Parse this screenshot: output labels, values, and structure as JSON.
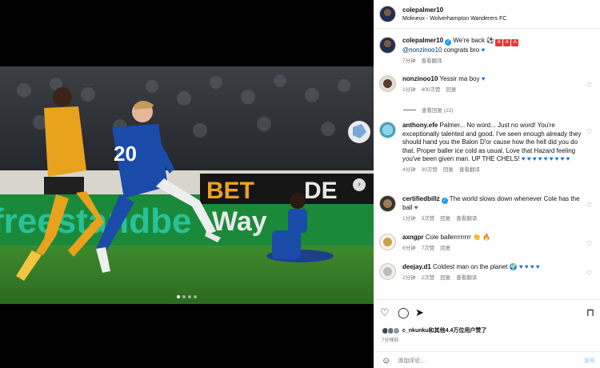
{
  "header": {
    "username": "colepalmer10",
    "location": "Molineux - Wolverhampton Wanderers FC"
  },
  "caption": {
    "username": "colepalmer10",
    "text": "We're back",
    "mention": "@nonzinoo10",
    "text2": "congrats bro",
    "time": "7分钟",
    "translate": "查看翻译"
  },
  "comments": [
    {
      "username": "nonzinoo10",
      "text": "Yessir ma boy",
      "time": "1分钟",
      "likes": "400次赞",
      "reply": "回复",
      "view_replies": "查看回复 (22)"
    },
    {
      "username": "anthony.efe",
      "text": "Palmer... No word... Just no word! You're exceptionally talented and good. I've seen enough already they should hand you the Balon D'or cause how the hell did you do that. Proper baller ice cold as usual. Love that Hazard feeling you've been given man. UP THE CHELS!",
      "time": "4分钟",
      "likes": "30次赞",
      "reply": "回复",
      "translate": "查看翻译"
    },
    {
      "username": "certifiedbillz",
      "text": "The world slows down whenever Cole has the ball",
      "time": "1分钟",
      "likes": "3次赞",
      "reply": "回复",
      "translate": "查看翻译"
    },
    {
      "username": "axngpr",
      "text": "Cole ballerrrrrrrr",
      "time": "6分钟",
      "likes": "7次赞",
      "reply": "回复"
    },
    {
      "username": "deejay.d1",
      "text": "Coldest man on the planet",
      "time": "2分钟",
      "likes": "2次赞",
      "reply": "回复",
      "translate": "查看翻译"
    }
  ],
  "footer": {
    "likes_text": "c_nkunku和其他4.4万位用户赞了",
    "time": "7分钟前",
    "comment_placeholder": "添加评论...",
    "post_label": "发布"
  },
  "colors": {
    "accent": "#0095f6",
    "chelsea_blue": "#1a4ba8",
    "wolves_gold": "#e8a21c"
  }
}
